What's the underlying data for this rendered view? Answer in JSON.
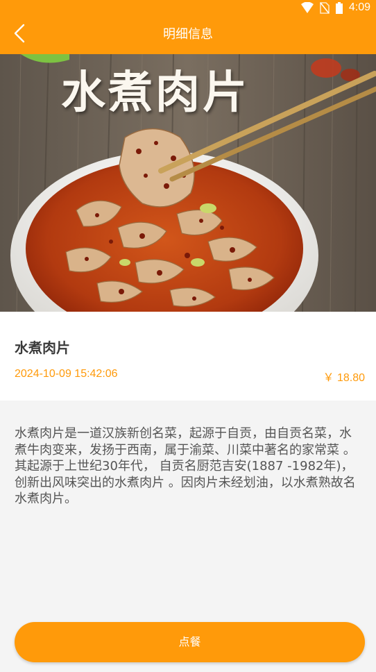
{
  "status_bar": {
    "time": "4:09",
    "icons": [
      "wifi-icon",
      "no-sim-icon",
      "battery-icon"
    ]
  },
  "app_bar": {
    "title": "明细信息",
    "back_icon": "chevron-left-icon"
  },
  "hero": {
    "overlay_text": "水煮肉片"
  },
  "dish": {
    "name": "水煮肉片",
    "datetime": "2024-10-09 15:42:06",
    "price": "￥ 18.80"
  },
  "description": "水煮肉片是一道汉族新创名菜，起源于自贡，由自贡名菜，水煮牛肉变来，发扬于西南，属于渝菜、川菜中著名的家常菜 。其起源于上世纪30年代， 自贡名厨范吉安(1887 -1982年)，创新出风味突出的水煮肉片 。因肉片未经划油，以水煮熟故名水煮肉片。",
  "order_button": {
    "label": "点餐"
  },
  "colors": {
    "accent": "#ff9a0a",
    "background": "#f4f4f4",
    "card": "#ffffff",
    "title_text": "#3a3a3a",
    "body_text": "#555555"
  }
}
